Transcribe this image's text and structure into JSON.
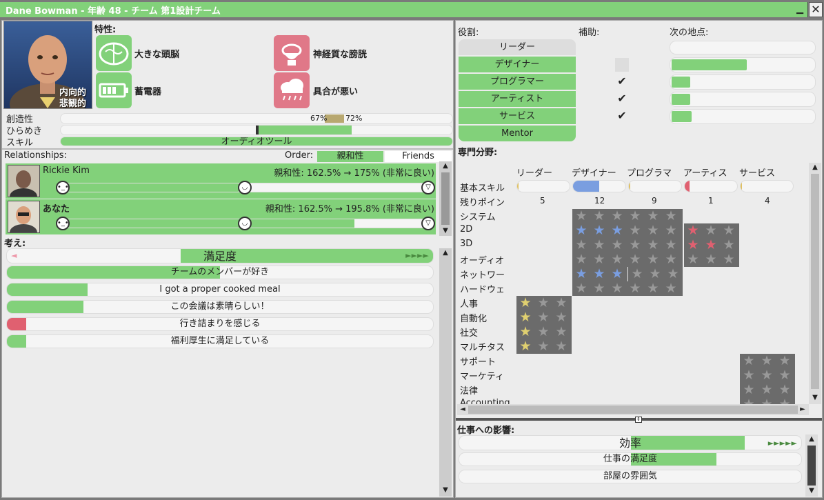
{
  "window": {
    "title": "Dane Bowman - 年齢 48 - チーム 第1設計チーム",
    "minimize": "▁",
    "close": "✕"
  },
  "portrait": {
    "tag1": "内向的",
    "tag2": "悲観的"
  },
  "traits": {
    "label": "特性:",
    "items": [
      {
        "name": "大きな頭脳",
        "icon": "brain-icon"
      },
      {
        "name": "神経質な膀胱",
        "icon": "toilet-icon"
      },
      {
        "name": "蓄電器",
        "icon": "battery-icon"
      },
      {
        "name": "具合が悪い",
        "icon": "rain-cloud-icon"
      }
    ]
  },
  "stats": {
    "creativity_label": "創造性",
    "inspiration_label": "ひらめき",
    "skill_label": "スキル",
    "creativity_low": "67%",
    "creativity_high": "72%",
    "creativity_low_value": 0.67,
    "creativity_high_value": 0.72,
    "skill_value": "オーディオツール"
  },
  "relationships": {
    "label": "Relationships:",
    "order_label": "Order:",
    "sort_compat": "親和性",
    "sort_friends": "Friends",
    "people": [
      {
        "name": "Rickie Kim",
        "compat": "親和性: 162.5% → 175% (非常に良い)",
        "level": 0.48
      },
      {
        "name": "あなた",
        "compat": "親和性: 162.5% → 195.8% (非常に良い)",
        "level": 0.79
      }
    ]
  },
  "thoughts": {
    "label": "考え:",
    "header": "満足度",
    "arrows": "►►►►",
    "left_arrow": "◄",
    "items": [
      {
        "text": "チームのメンバーが好き",
        "fill": 0.5,
        "color": "#82d17a"
      },
      {
        "text": "I got a proper cooked meal",
        "fill": 0.19,
        "color": "#82d17a"
      },
      {
        "text": "この会議は素晴らしい！",
        "fill": 0.18,
        "color": "#82d17a"
      },
      {
        "text": "行き詰まりを感じる",
        "fill": 0.045,
        "color": "#e06070"
      },
      {
        "text": "福利厚生に満足している",
        "fill": 0.045,
        "color": "#82d17a"
      }
    ]
  },
  "roles": {
    "role_label": "役割:",
    "assist_label": "補助:",
    "next_label": "次の地点:",
    "items": [
      {
        "name": "リーダー",
        "checked": false,
        "next": 0.0,
        "active": false
      },
      {
        "name": "デザイナー",
        "checked": false,
        "next": 0.52,
        "active": true
      },
      {
        "name": "プログラマー",
        "checked": true,
        "next": 0.13,
        "active": true
      },
      {
        "name": "アーティスト",
        "checked": true,
        "next": 0.13,
        "active": true
      },
      {
        "name": "サービス",
        "checked": true,
        "next": 0.14,
        "active": true
      },
      {
        "name": "Mentor",
        "checked": false,
        "next": null,
        "active": true
      }
    ],
    "check": "✔"
  },
  "specialization": {
    "label": "専門分野:",
    "columns": [
      "リーダー",
      "デザイナー",
      "プログラマ",
      "アーティス",
      "サービス"
    ],
    "basic_label": "基本スキル",
    "remaining_label": "残りポイン",
    "remaining": [
      "5",
      "12",
      "9",
      "1",
      "4"
    ],
    "basic_fill": [
      0.02,
      0.5,
      0.02,
      0.08,
      0.02
    ],
    "basic_colors": [
      "#e0c060",
      "#7a9ee0",
      "#e0c060",
      "#e06070",
      "#e0c060"
    ],
    "rows": [
      "システム",
      "2D",
      "3D",
      "オーディオ",
      "ネットワー",
      "ハードウェ",
      "人事",
      "自動化",
      "社交",
      "マルチタス",
      "サポート",
      "マーケティ",
      "法律",
      "Accounting"
    ],
    "star": "★"
  },
  "impact": {
    "label": "仕事への影響:",
    "header": "効率",
    "arrows": "►►►►►",
    "items": [
      {
        "text": "仕事の満足度",
        "fill": 0.42
      },
      {
        "text": "部屋の雰囲気",
        "fill": 0.0
      }
    ]
  }
}
